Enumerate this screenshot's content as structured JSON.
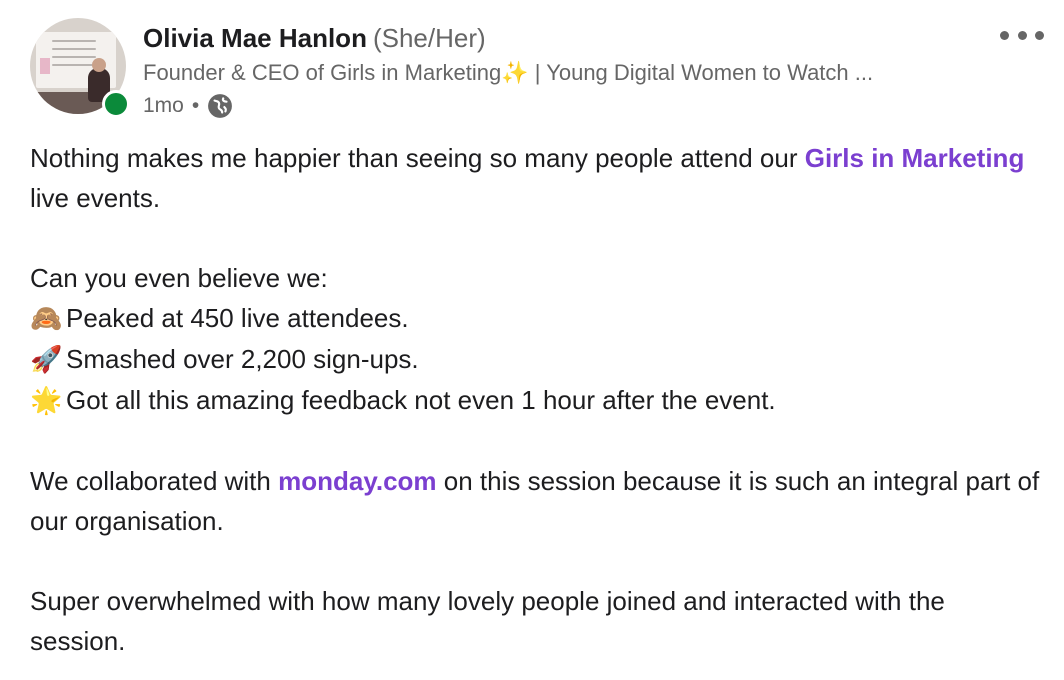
{
  "post": {
    "author": {
      "name": "Olivia Mae Hanlon",
      "pronouns": "(She/Her)",
      "headline_before": "Founder & CEO of Girls in Marketing",
      "headline_sparkle": "✨",
      "headline_after": " | Young Digital Women to Watch ...",
      "online": true
    },
    "time": "1mo",
    "separator": "•",
    "visibility_icon": "globe-icon",
    "menu_icon": "more-horizontal-icon",
    "body": {
      "p1_before": "Nothing makes me happier than seeing so many people attend our ",
      "p1_link": "Girls in Marketing",
      "p1_after": " live events.",
      "p2_intro": "Can you even believe we:",
      "bullets": [
        {
          "emoji": "🙈",
          "text": "Peaked at 450 live attendees."
        },
        {
          "emoji": "🚀",
          "text": "Smashed over 2,200 sign-ups."
        },
        {
          "emoji": "🌟",
          "text": "Got all this amazing feedback not even 1 hour after the event."
        }
      ],
      "p3_before": "We collaborated with ",
      "p3_link": "monday.com",
      "p3_after": " on this session because it is such an integral part of our organisation.",
      "p4": "Super overwhelmed with how many lovely people joined and interacted with the session."
    }
  },
  "colors": {
    "link": "#7b3fd0",
    "online": "#0b8a3a",
    "muted": "#666666"
  }
}
